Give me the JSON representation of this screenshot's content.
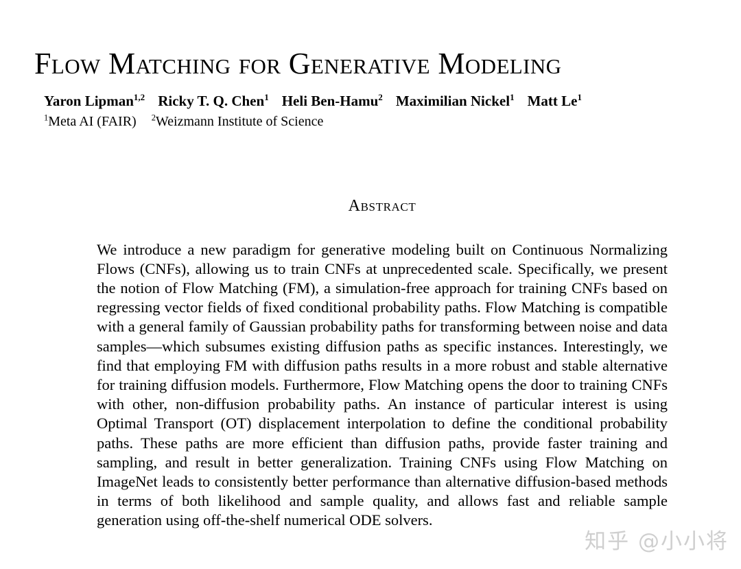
{
  "document": {
    "title": "Flow Matching for Generative Modeling",
    "authors": [
      {
        "name": "Yaron Lipman",
        "affiliation_marks": "1,2"
      },
      {
        "name": "Ricky T. Q. Chen",
        "affiliation_marks": "1"
      },
      {
        "name": "Heli Ben-Hamu",
        "affiliation_marks": "2"
      },
      {
        "name": "Maximilian Nickel",
        "affiliation_marks": "1"
      },
      {
        "name": "Matt Le",
        "affiliation_marks": "1"
      }
    ],
    "affiliations": [
      {
        "mark": "1",
        "name": "Meta AI (FAIR)"
      },
      {
        "mark": "2",
        "name": "Weizmann Institute of Science"
      }
    ],
    "abstract": {
      "heading": "Abstract",
      "text": "We introduce a new paradigm for generative modeling built on Continuous Normalizing Flows (CNFs), allowing us to train CNFs at unprecedented scale. Specifically, we present the notion of Flow Matching (FM), a simulation-free approach for training CNFs based on regressing vector fields of fixed conditional probability paths. Flow Matching is compatible with a general family of Gaussian probability paths for transforming between noise and data samples—which subsumes existing diffusion paths as specific instances. Interestingly, we find that employing FM with diffusion paths results in a more robust and stable alternative for training diffusion models. Furthermore, Flow Matching opens the door to training CNFs with other, non-diffusion probability paths. An instance of particular interest is using Optimal Transport (OT) displacement interpolation to define the conditional probability paths. These paths are more efficient than diffusion paths, provide faster training and sampling, and result in better generalization. Training CNFs using Flow Matching on ImageNet leads to consistently better performance than alternative diffusion-based methods in terms of both likelihood and sample quality, and allows fast and reliable sample generation using off-the-shelf numerical ODE solvers."
    }
  },
  "watermark": {
    "text": "知乎 @小小将",
    "color": "#cfcfcf"
  }
}
